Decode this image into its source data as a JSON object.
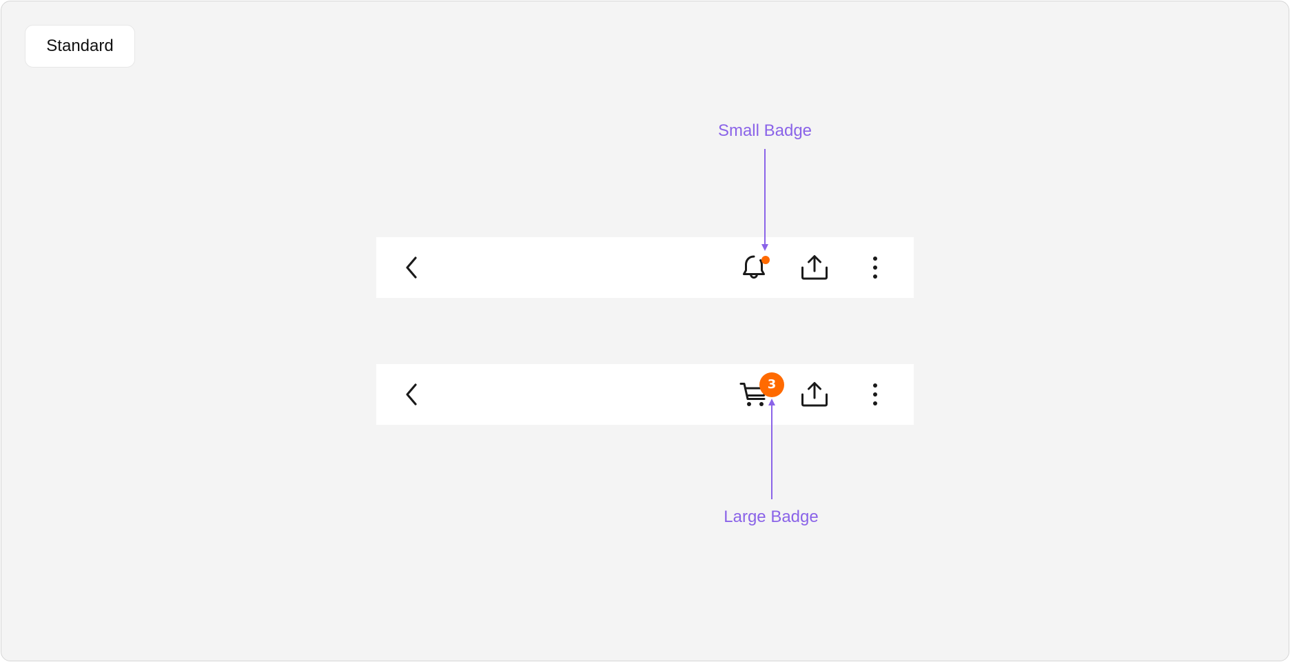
{
  "variant_chip": {
    "label": "Standard"
  },
  "colors": {
    "background": "#f4f4f4",
    "surface": "#ffffff",
    "icon": "#1a1a1a",
    "badge": "#ff6a00",
    "annotation": "#8a63e8"
  },
  "app_bars": [
    {
      "leading_icon": "chevron-left-icon",
      "actions": [
        "bell-icon",
        "share-upload-icon",
        "more-vertical-icon"
      ],
      "badge": {
        "type": "small",
        "on": "bell-icon"
      }
    },
    {
      "leading_icon": "chevron-left-icon",
      "actions": [
        "cart-icon",
        "share-upload-icon",
        "more-vertical-icon"
      ],
      "badge": {
        "type": "large",
        "on": "cart-icon",
        "count": "3"
      }
    }
  ],
  "annotations": {
    "small_badge": "Small Badge",
    "large_badge": "Large Badge"
  }
}
